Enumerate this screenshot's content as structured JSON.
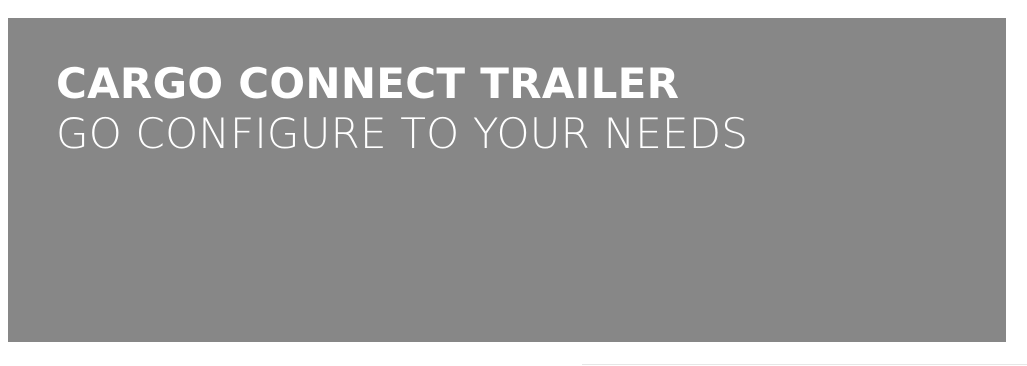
{
  "hero": {
    "title": "CARGO CONNECT TRAILER",
    "subtitle": "GO CONFIGURE TO YOUR NEEDS",
    "background_color": "#878787",
    "text_color": "#ffffff"
  },
  "page": {
    "background_color": "#ffffff",
    "divider_color": "#e6e6e6"
  }
}
